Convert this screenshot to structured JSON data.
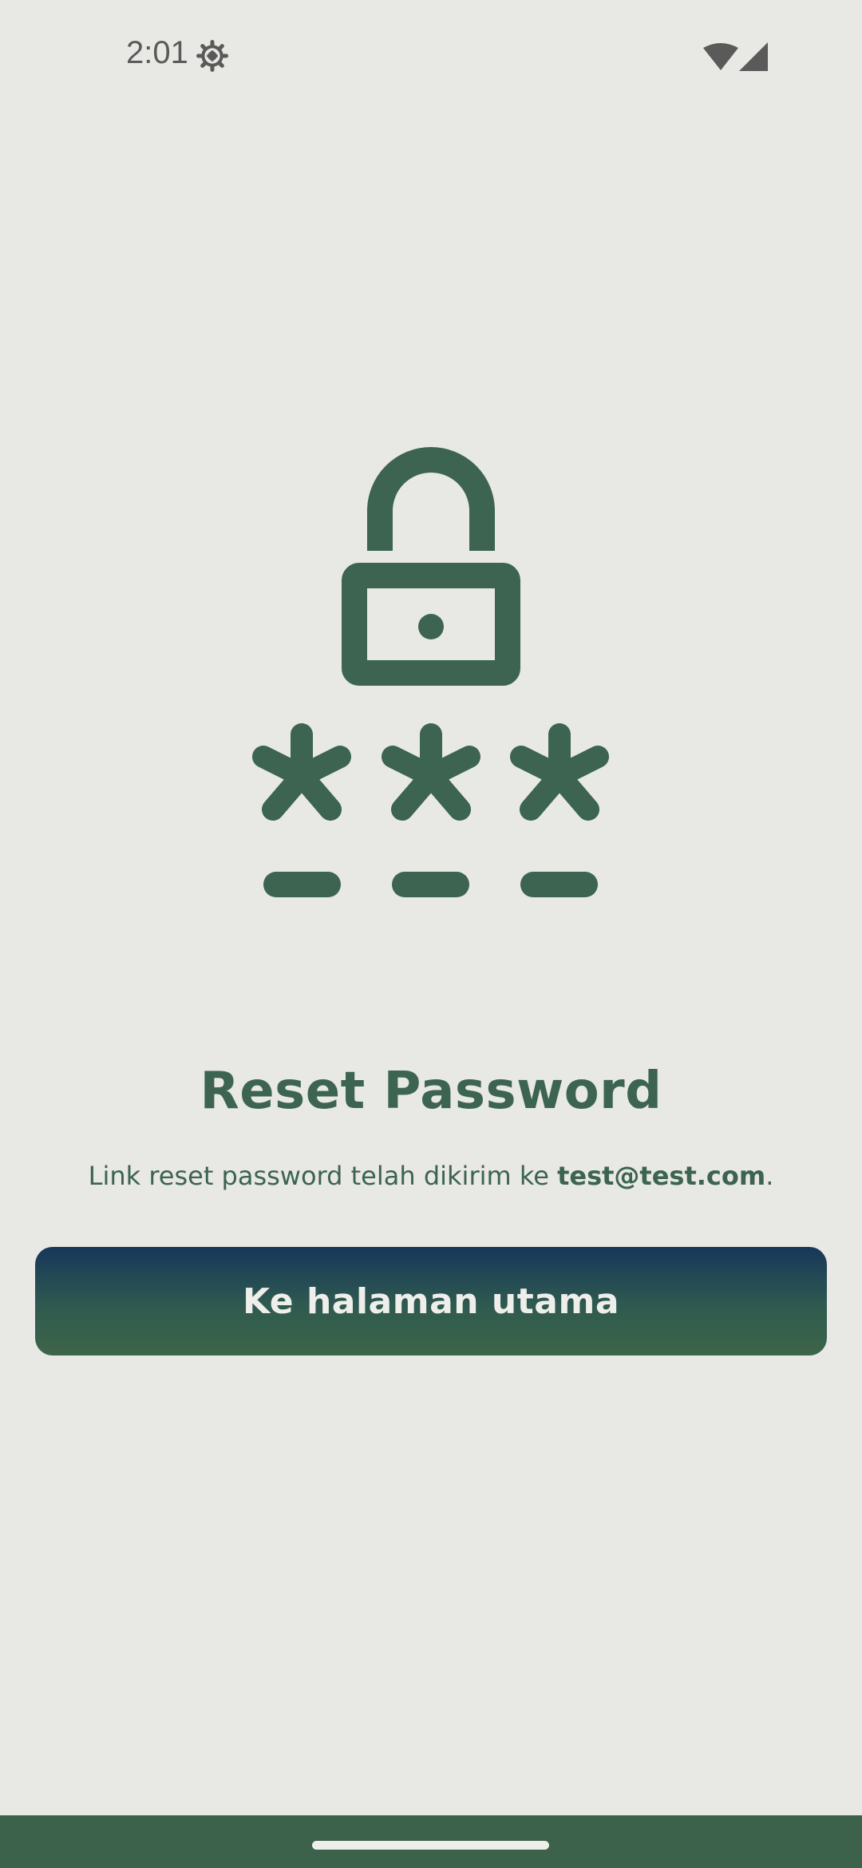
{
  "status_bar": {
    "time": "2:01",
    "icons": [
      "gear-icon",
      "wifi-icon",
      "signal-icon"
    ]
  },
  "hero": {
    "icon": "password-lock-icon"
  },
  "title": "Reset Password",
  "message": {
    "prefix": "Link reset password telah dikirim ke ",
    "email": "test@test.com",
    "suffix": "."
  },
  "primary_button": {
    "label": "Ke halaman utama"
  },
  "colors": {
    "background": "#e8e8e4",
    "accent_green": "#3c6450",
    "button_gradient_top": "#17375a",
    "button_gradient_bottom": "#3d6549",
    "nav_bar": "#3c624b"
  }
}
